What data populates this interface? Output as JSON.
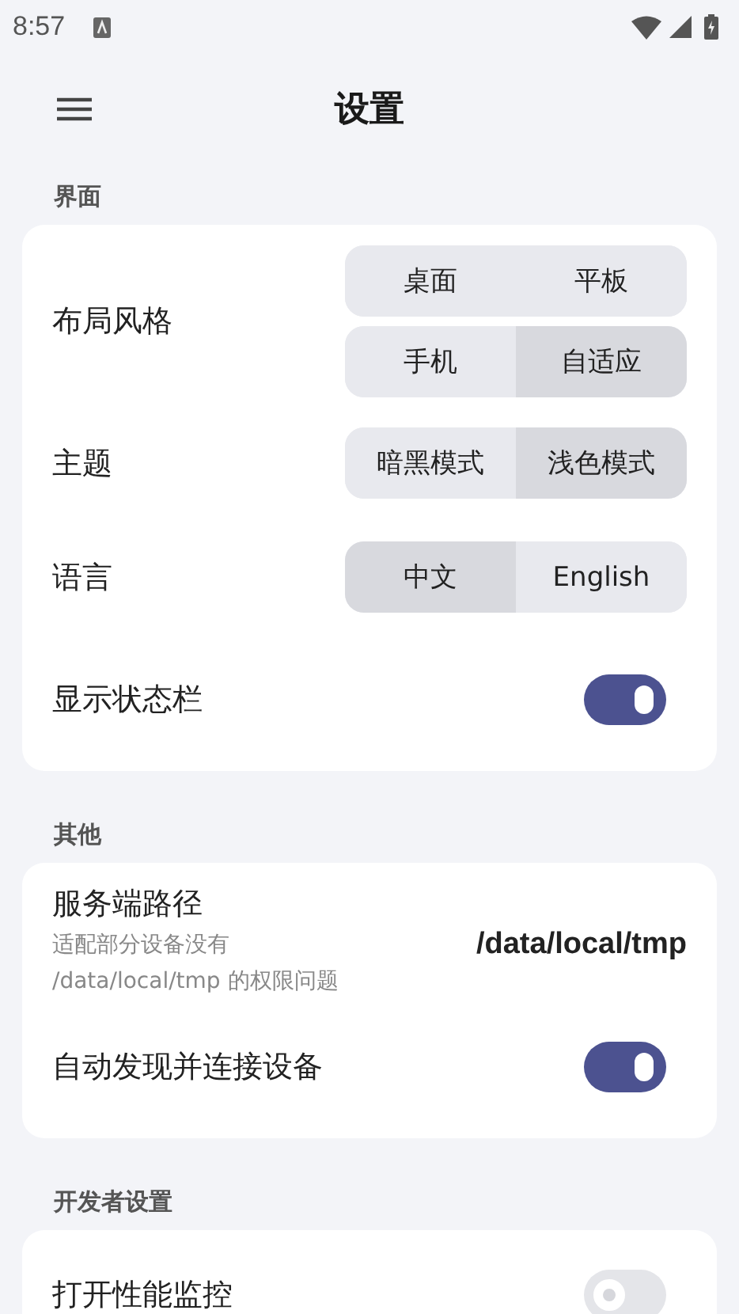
{
  "status_bar": {
    "time": "8:57"
  },
  "app_bar": {
    "title": "设置"
  },
  "sections": [
    {
      "title": "界面",
      "rows": [
        {
          "kind": "segmented",
          "label": "布局风格",
          "groups": [
            [
              {
                "label": "桌面",
                "selected": false
              },
              {
                "label": "平板",
                "selected": false
              }
            ],
            [
              {
                "label": "手机",
                "selected": false
              },
              {
                "label": "自适应",
                "selected": true
              }
            ]
          ]
        },
        {
          "kind": "segmented",
          "label": "主题",
          "groups": [
            [
              {
                "label": "暗黑模式",
                "selected": false
              },
              {
                "label": "浅色模式",
                "selected": true
              }
            ]
          ]
        },
        {
          "kind": "segmented",
          "label": "语言",
          "groups": [
            [
              {
                "label": "中文",
                "selected": true
              },
              {
                "label": "English",
                "selected": false
              }
            ]
          ]
        },
        {
          "kind": "toggle",
          "label": "显示状态栏",
          "on": true
        }
      ]
    },
    {
      "title": "其他",
      "rows": [
        {
          "kind": "value",
          "label": "服务端路径",
          "description": "适配部分设备没有\n/data/local/tmp 的权限问题",
          "value": "/data/local/tmp"
        },
        {
          "kind": "toggle",
          "label": "自动发现并连接设备",
          "on": true
        }
      ]
    },
    {
      "title": "开发者设置",
      "rows": [
        {
          "kind": "toggle",
          "label": "打开性能监控",
          "on": false
        }
      ]
    }
  ]
}
